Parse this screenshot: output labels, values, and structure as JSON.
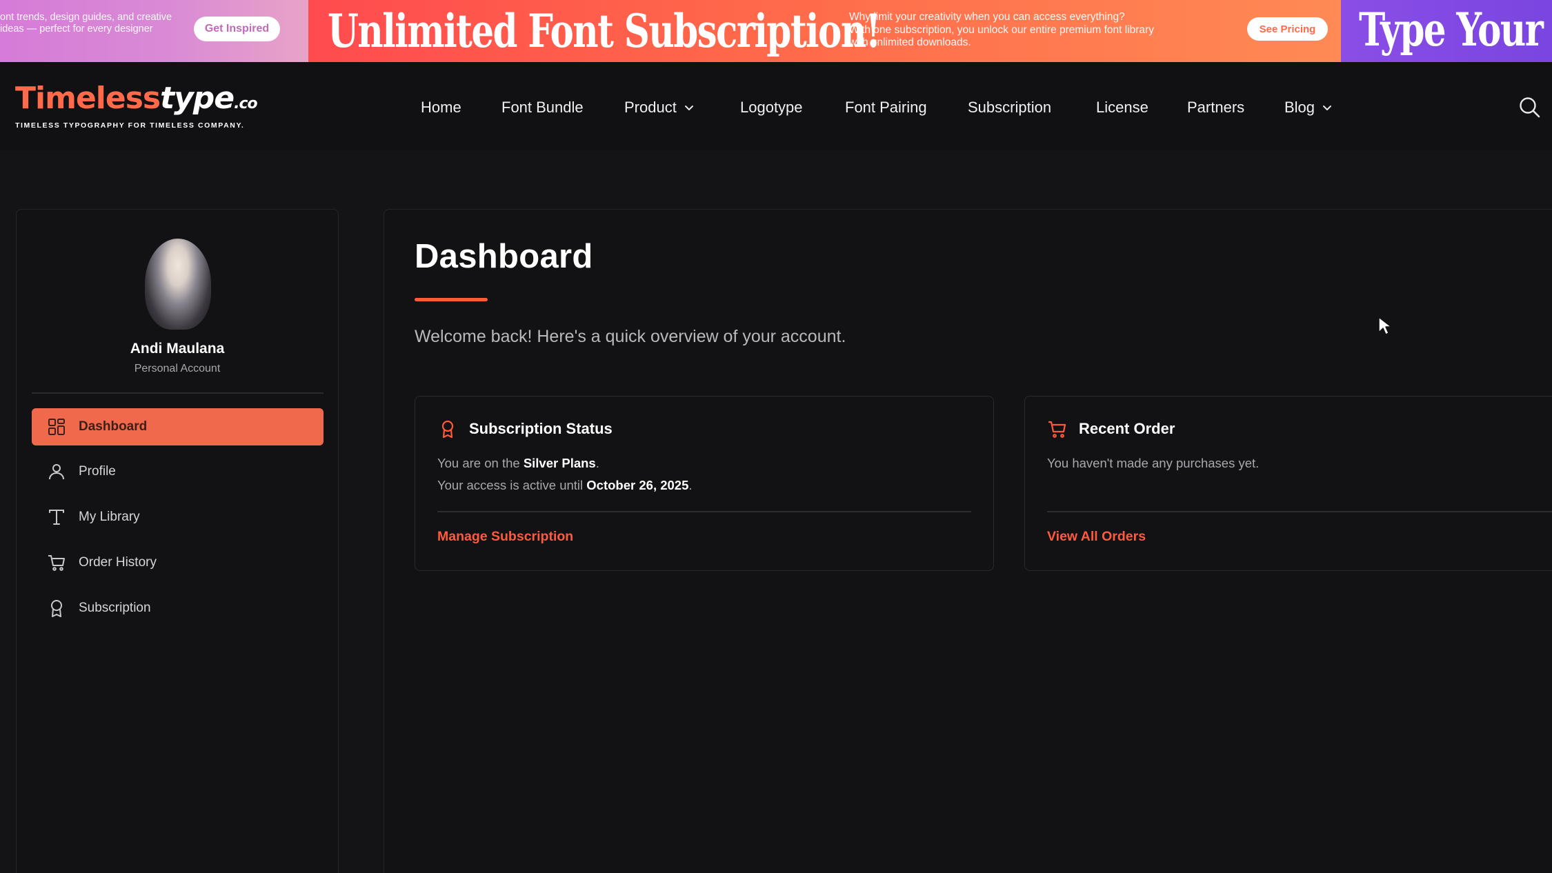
{
  "promo": {
    "left_text": "ont trends, design guides, and creative\nideas — perfect for every designer",
    "left_button": "Get Inspired",
    "headline": "Unlimited Font Subscription!",
    "mid_text": "Why limit your creativity when you can access everything?\nWith one subscription, you unlock our entire premium font library\nwith unlimited downloads.",
    "mid_button": "See Pricing",
    "right_headline": "Type Your"
  },
  "logo": {
    "part1": "Timeless",
    "part2": "type",
    "part3": ".co",
    "tagline": "TIMELESS TYPOGRAPHY FOR TIMELESS COMPANY."
  },
  "nav": {
    "home": "Home",
    "font_bundle": "Font Bundle",
    "product": "Product",
    "logotype": "Logotype",
    "font_pairing": "Font Pairing",
    "subscription": "Subscription",
    "license": "License",
    "partners": "Partners",
    "blog": "Blog"
  },
  "user": {
    "name": "Andi Maulana",
    "account_type": "Personal Account"
  },
  "sidebar": {
    "items": [
      {
        "label": "Dashboard",
        "icon": "dashboard-grid-icon",
        "active": true
      },
      {
        "label": "Profile",
        "icon": "user-icon",
        "active": false
      },
      {
        "label": "My Library",
        "icon": "type-t-icon",
        "active": false
      },
      {
        "label": "Order History",
        "icon": "cart-icon",
        "active": false
      },
      {
        "label": "Subscription",
        "icon": "award-icon",
        "active": false
      }
    ]
  },
  "main": {
    "title": "Dashboard",
    "welcome": "Welcome back! Here's a quick overview of your account.",
    "subscription_card": {
      "title": "Subscription Status",
      "line1_prefix": "You are on the",
      "plan": "Silver Plans",
      "line1_suffix": ".",
      "line2_prefix": "Your access is active until",
      "date": "October 26, 2025",
      "line2_suffix": ".",
      "link": "Manage Subscription"
    },
    "order_card": {
      "title": "Recent Order",
      "message": "You haven't made any purchases yet.",
      "link": "View All Orders"
    }
  },
  "colors": {
    "accent": "#ff5a3c",
    "active_bg": "#f0694d",
    "background": "#141316"
  }
}
